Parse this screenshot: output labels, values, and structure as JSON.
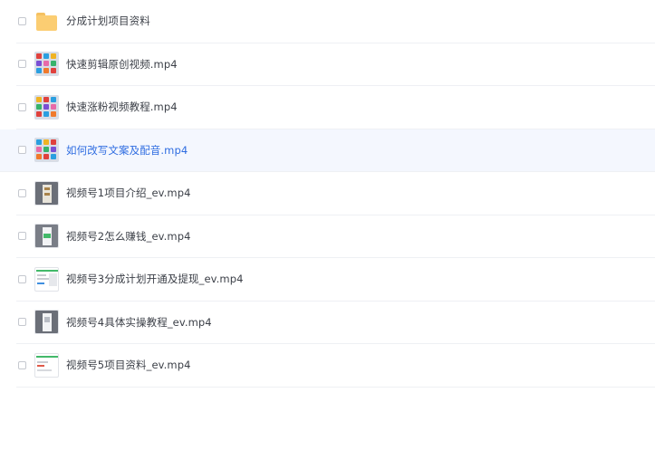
{
  "files": [
    {
      "name": "分成计划项目资料",
      "icon": "folder-icon"
    },
    {
      "name": "快速剪辑原创视频.mp4",
      "icon": "video-thumbnail-icon"
    },
    {
      "name": "快速涨粉视频教程.mp4",
      "icon": "video-thumbnail-icon"
    },
    {
      "name": "如何改写文案及配音.mp4",
      "icon": "video-thumbnail-icon",
      "highlighted": true
    },
    {
      "name": "视频号1项目介绍_ev.mp4",
      "icon": "screen-recording-thumbnail-icon"
    },
    {
      "name": "视频号2怎么赚钱_ev.mp4",
      "icon": "screen-recording-thumbnail-icon"
    },
    {
      "name": "视频号3分成计划开通及提现_ev.mp4",
      "icon": "screen-recording-thumbnail-icon"
    },
    {
      "name": "视频号4具体实操教程_ev.mp4",
      "icon": "screen-recording-thumbnail-icon"
    },
    {
      "name": "视频号5项目资料_ev.mp4",
      "icon": "screen-recording-thumbnail-icon"
    }
  ],
  "colors": {
    "highlight_background": "#f4f7fe",
    "highlight_text": "#2f6de1",
    "text": "#3b3f47",
    "folder": "#fbcd72"
  }
}
